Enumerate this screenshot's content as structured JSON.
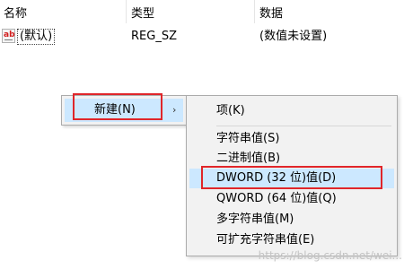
{
  "columns": {
    "name": "名称",
    "type": "类型",
    "data": "数据"
  },
  "rows": [
    {
      "icon": "string-value-icon",
      "icon_text": "ab",
      "name": "(默认)",
      "type": "REG_SZ",
      "data": "(数值未设置)"
    }
  ],
  "context_menu": {
    "new_label": "新建(N)",
    "arrow": "›"
  },
  "submenu": {
    "items": [
      "项(K)",
      "字符串值(S)",
      "二进制值(B)",
      "DWORD (32 位)值(D)",
      "QWORD (64 位)值(Q)",
      "多字符串值(M)",
      "可扩充字符串值(E)"
    ],
    "highlighted_index": 3
  },
  "colors": {
    "selection": "#cce8ff",
    "annotation": "#e0262a",
    "menu_bg": "#f2f2f2"
  },
  "watermark": "https://blog.csdn.net/wei..."
}
